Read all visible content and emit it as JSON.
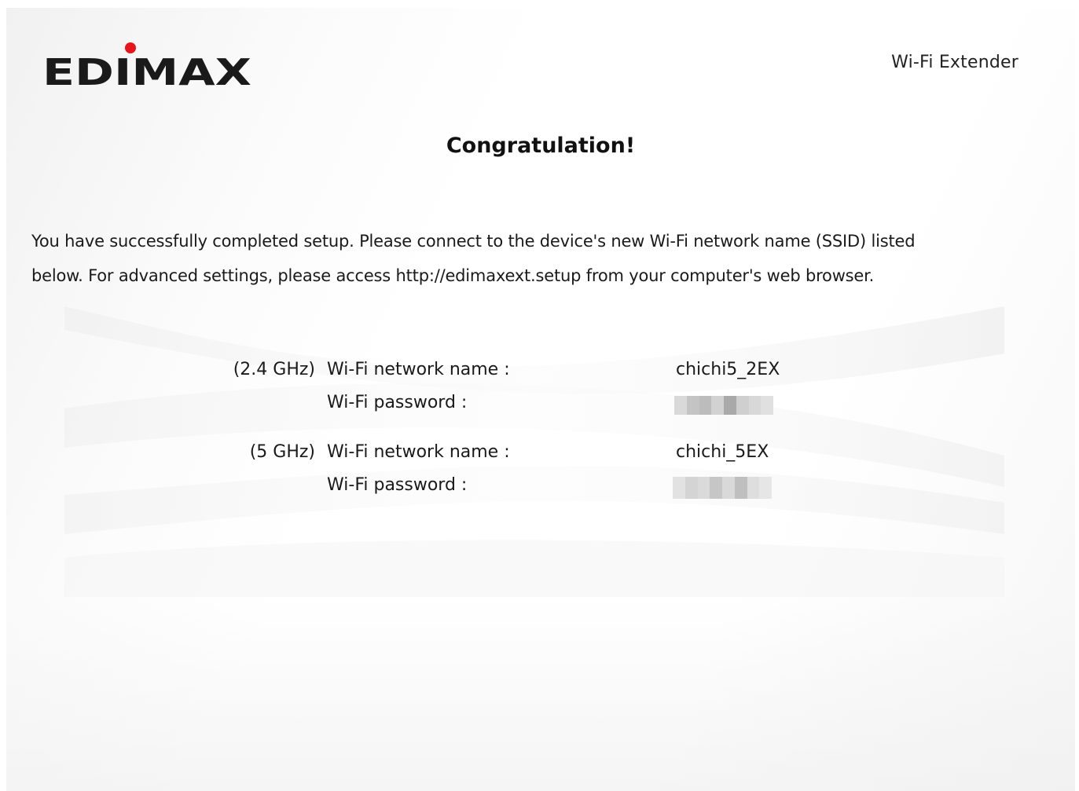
{
  "header": {
    "logo_text": "EDIMAX",
    "product_name": "Wi-Fi Extender"
  },
  "main": {
    "title": "Congratulation!",
    "message_line1": "You have successfully completed setup. Please connect to the device's new Wi-Fi network name (SSID) listed",
    "message_line2": "below. For advanced settings, please access http://edimaxext.setup from your computer's web browser.",
    "networks": [
      {
        "band": "(2.4 GHz)",
        "ssid_label": "Wi-Fi network name :",
        "ssid": "chichi5_2EX",
        "password_label": "Wi-Fi password :"
      },
      {
        "band": "(5 GHz)",
        "ssid_label": "Wi-Fi network name :",
        "ssid": "chichi_5EX",
        "password_label": "Wi-Fi password :"
      }
    ]
  },
  "colors": {
    "logo_dot": "#e8141b",
    "logo_text": "#1a1a1a",
    "blur_light": "#dcdcdc",
    "blur_dark": "#b0b0b0"
  }
}
